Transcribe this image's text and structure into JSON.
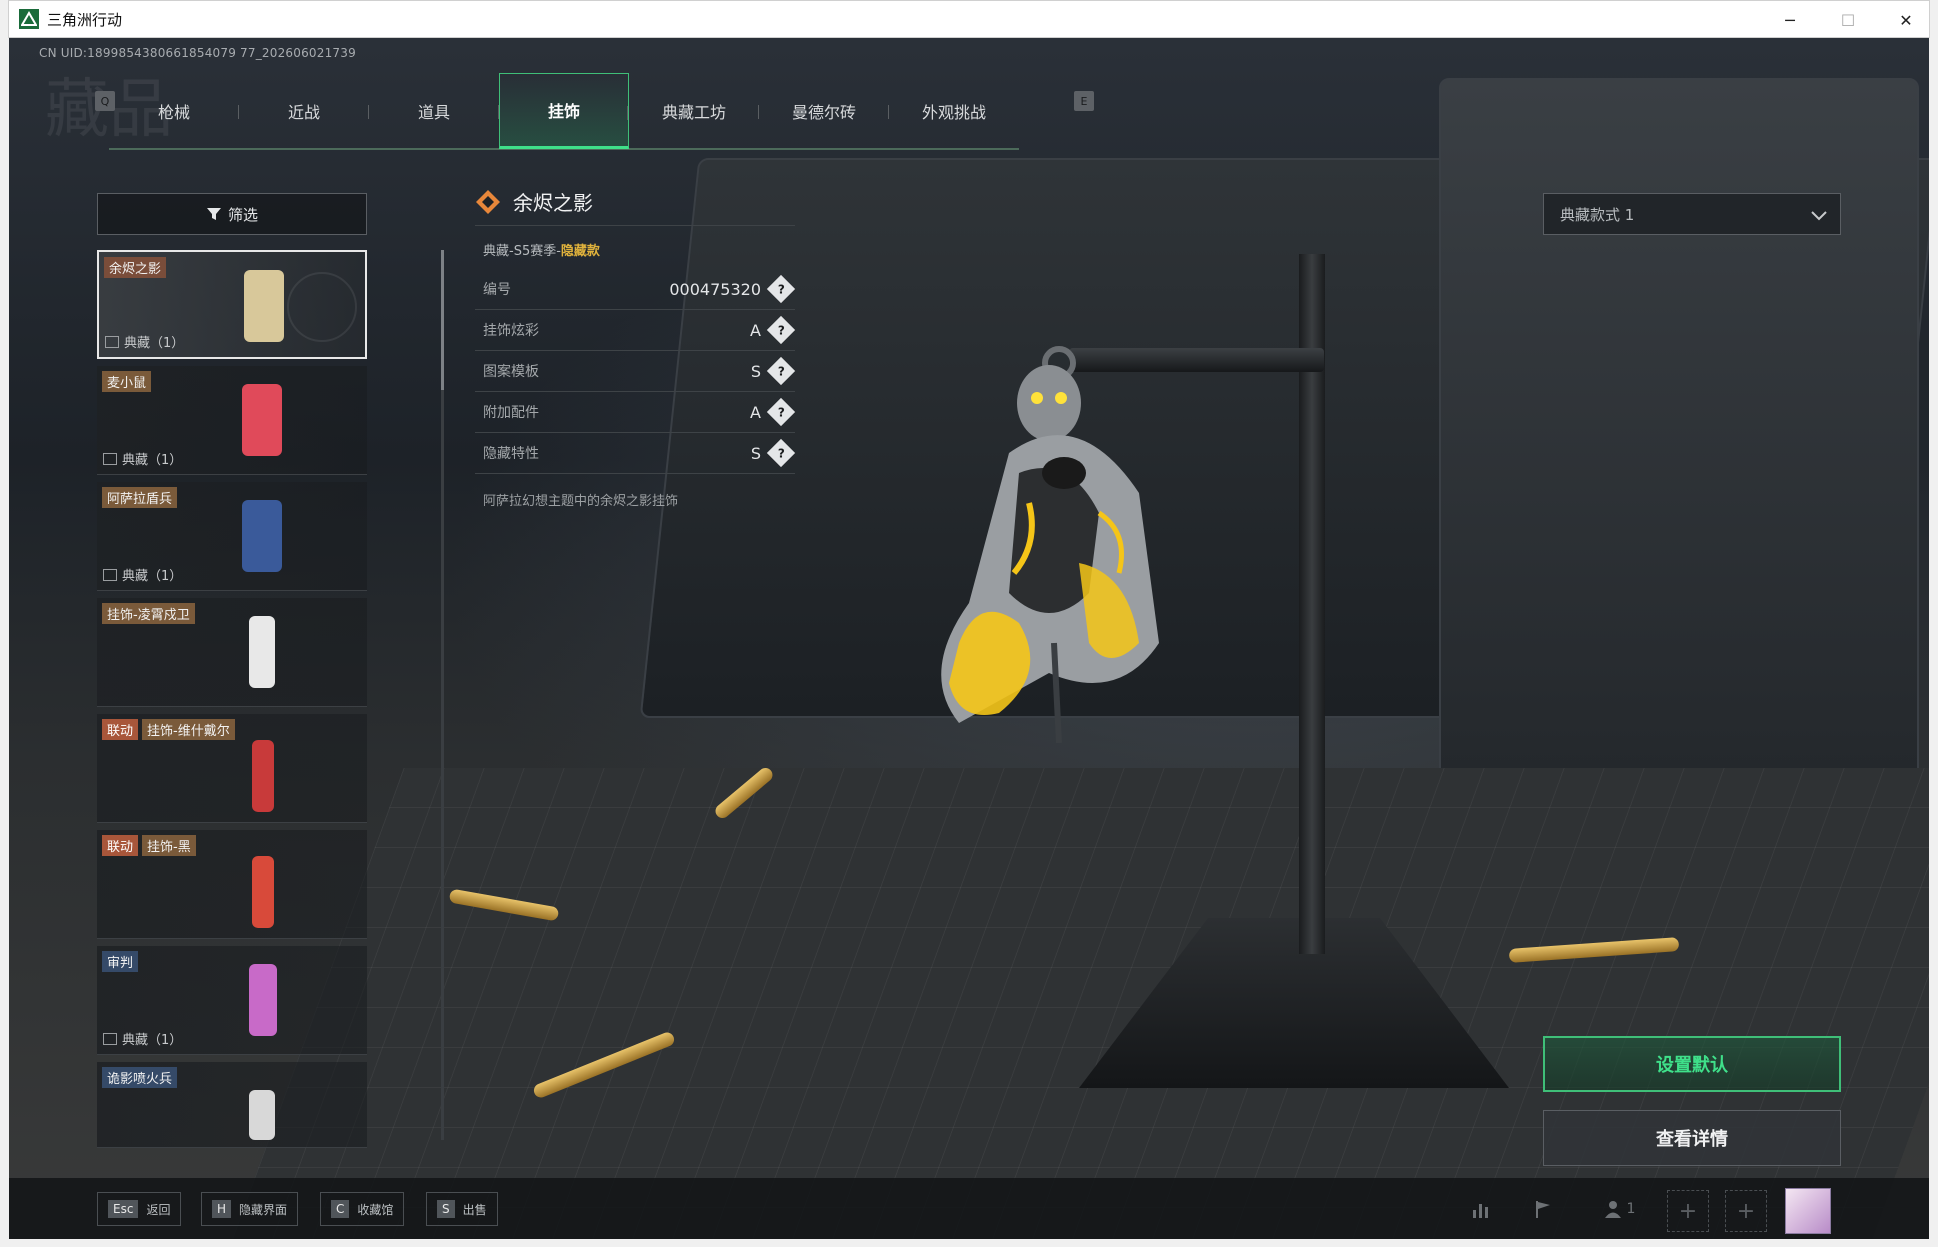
{
  "window": {
    "title": "三角洲行动",
    "minimize": "─",
    "maximize": "☐",
    "close": "✕"
  },
  "uid": "CN UID:1899854380661854079 77_202606021739",
  "header": {
    "watermark": "藏品"
  },
  "tabs": {
    "key_left": "Q",
    "key_right": "E",
    "items": [
      {
        "label": "枪械"
      },
      {
        "label": "近战"
      },
      {
        "label": "道具"
      },
      {
        "label": "挂饰"
      },
      {
        "label": "典藏工坊"
      },
      {
        "label": "曼德尔砖"
      },
      {
        "label": "外观挑战"
      }
    ],
    "active_index": 3
  },
  "filter": {
    "label": "筛选"
  },
  "list": {
    "items": [
      {
        "name": "余烬之影",
        "collab": "",
        "count": "典藏（1）",
        "color": "#d8c89a"
      },
      {
        "name": "麦小鼠",
        "collab": "",
        "count": "典藏（1）",
        "color": "#e04a5a"
      },
      {
        "name": "阿萨拉盾兵",
        "collab": "",
        "count": "典藏（1）",
        "color": "#3a5a9a"
      },
      {
        "name": "挂饰-凌霄戍卫",
        "collab": "",
        "count": "",
        "color": "#e8e8e8"
      },
      {
        "name": "挂饰-维什戴尔",
        "collab": "联动",
        "count": "",
        "color": "#c83a3a"
      },
      {
        "name": "挂饰-黑",
        "collab": "联动",
        "count": "",
        "color": "#d84a3a"
      },
      {
        "name": "审判",
        "collab": "",
        "count": "典藏（1）",
        "color": "#c86ac8"
      },
      {
        "name": "诡影喷火兵",
        "collab": "",
        "count": "",
        "color": "#d8d8d8"
      }
    ]
  },
  "detail": {
    "name": "余烬之影",
    "season_prefix": "典藏-S5赛季-",
    "season_hidden": "隐藏款",
    "rows": [
      {
        "label": "编号",
        "value": "000475320"
      },
      {
        "label": "挂饰炫彩",
        "value": "A"
      },
      {
        "label": "图案模板",
        "value": "S"
      },
      {
        "label": "附加配件",
        "value": "A"
      },
      {
        "label": "隐藏特性",
        "value": "S"
      }
    ],
    "help": "?",
    "description": "阿萨拉幻想主题中的余烬之影挂饰"
  },
  "style_select": {
    "value": "典藏款式 1"
  },
  "actions": {
    "set_default": "设置默认",
    "view_detail": "查看详情"
  },
  "bottom": {
    "hints": [
      {
        "key": "Esc",
        "label": "返回"
      },
      {
        "key": "H",
        "label": "隐藏界面"
      },
      {
        "key": "C",
        "label": "收藏馆"
      },
      {
        "key": "S",
        "label": "出售"
      }
    ],
    "party_count": "1",
    "slot_plus": "+"
  },
  "colors": {
    "accent": "#3fe08a",
    "hidden_gold": "#e0b23c",
    "tag_bg": "#7a4d3a",
    "collab_bg": "#a8563a"
  }
}
